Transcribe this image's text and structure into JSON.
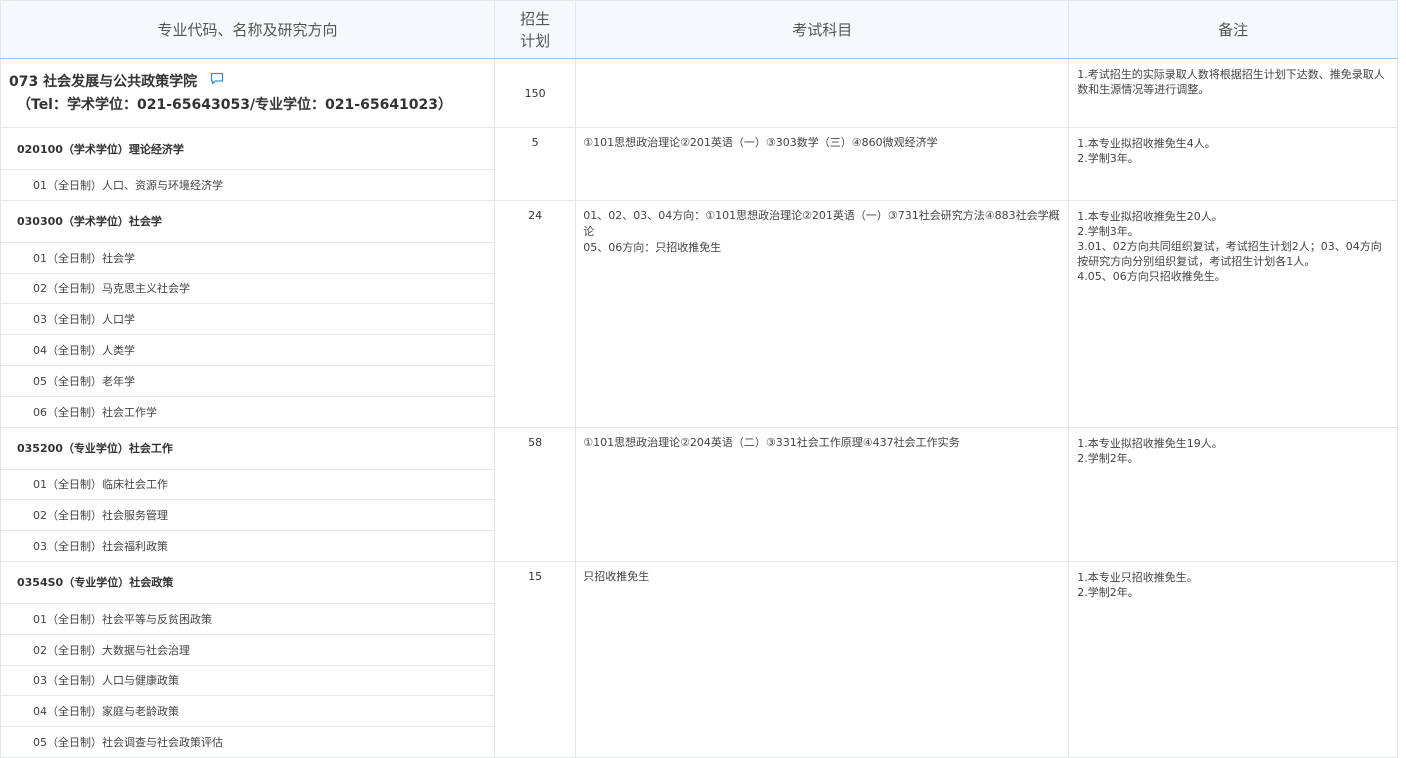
{
  "header": {
    "col_name": "专业代码、名称及研究方向",
    "col_plan_line1": "招生",
    "col_plan_line2": "计划",
    "col_exam": "考试科目",
    "col_note": "备注"
  },
  "school": {
    "name": "073 社会发展与公共政策学院",
    "tel": "（Tel：学术学位：021-65643053/专业学位：021-65641023）",
    "plan": "150",
    "note": "1.考试招生的实际录取人数将根据招生计划下达数、推免录取人数和生源情况等进行调整。",
    "icon": "message-icon"
  },
  "majors": [
    {
      "title": "020100（学术学位）理论经济学",
      "plan": "5",
      "exam": [
        "①101思想政治理论②201英语（一）③303数学（三）④860微观经济学"
      ],
      "notes": [
        "1.本专业拟招收推免生4人。",
        "2.学制3年。"
      ],
      "directions": [
        "01（全日制）人口、资源与环境经济学"
      ]
    },
    {
      "title": "030300（学术学位）社会学",
      "plan": "24",
      "exam": [
        "01、02、03、04方向：①101思想政治理论②201英语（一）③731社会研究方法④883社会学概论",
        "05、06方向：只招收推免生"
      ],
      "notes": [
        "1.本专业拟招收推免生20人。",
        "2.学制3年。",
        "3.01、02方向共同组织复试，考试招生计划2人；03、04方向按研究方向分别组织复试，考试招生计划各1人。",
        "4.05、06方向只招收推免生。"
      ],
      "directions": [
        "01（全日制）社会学",
        "02（全日制）马克思主义社会学",
        "03（全日制）人口学",
        "04（全日制）人类学",
        "05（全日制）老年学",
        "06（全日制）社会工作学"
      ]
    },
    {
      "title": "035200（专业学位）社会工作",
      "plan": "58",
      "exam": [
        "①101思想政治理论②204英语（二）③331社会工作原理④437社会工作实务"
      ],
      "notes": [
        "1.本专业拟招收推免生19人。",
        "2.学制2年。"
      ],
      "directions": [
        "01（全日制）临床社会工作",
        "02（全日制）社会服务管理",
        "03（全日制）社会福利政策"
      ]
    },
    {
      "title": "0354S0（专业学位）社会政策",
      "plan": "15",
      "exam": [
        "只招收推免生"
      ],
      "notes": [
        "1.本专业只招收推免生。",
        "2.学制2年。"
      ],
      "directions": [
        "01（全日制）社会平等与反贫困政策",
        "02（全日制）大数据与社会治理",
        "03（全日制）人口与健康政策",
        "04（全日制）家庭与老龄政策",
        "05（全日制）社会调查与社会政策评估"
      ]
    }
  ]
}
